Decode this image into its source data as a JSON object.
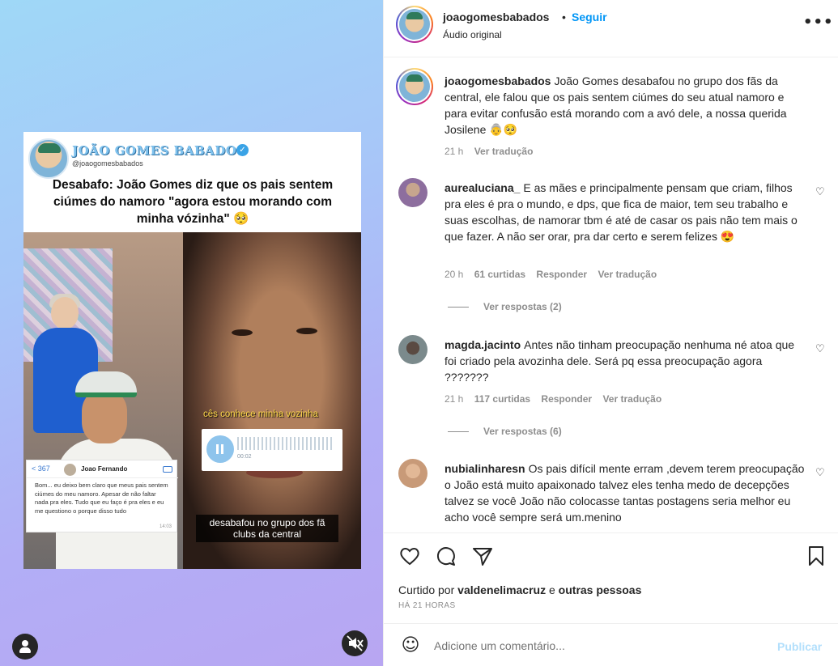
{
  "media": {
    "card_brand": "JOÃO GOMES BABADOS",
    "card_handle": "@joaogomesbabados",
    "card_headline": "Desabafo: João Gomes diz que os pais sentem ciúmes do namoro \"agora estou morando com minha vózinha\" 🥺",
    "caption_yellow": "cês conhece minha vozinha",
    "audio_time": "00:02",
    "caption_white": "desabafou no grupo dos fã clubs da central",
    "chat": {
      "back": "< 367",
      "name": "Joao Fernando",
      "message": "Bom... eu deixo bem claro que meus pais sentem ciúmes do meu namoro. Apesar de não faltar nada pra eles. Tudo que eu faço é pra eles e eu me questiono o porque disso tudo",
      "time": "14:03"
    }
  },
  "header": {
    "username": "joaogomesbabados",
    "separator": "•",
    "follow": "Seguir",
    "subtitle": "Áudio original",
    "more": "•••"
  },
  "caption": {
    "username": "joaogomesbabados",
    "text": "João Gomes desabafou no grupo dos fãs da central, ele falou que os pais sentem ciúmes do seu atual namoro e para evitar confusão está morando com a avó dele, a nossa querida Josilene 👵🥺",
    "time": "21 h",
    "translate": "Ver tradução"
  },
  "comments": [
    {
      "username": "aurealuciana_",
      "text": "E as mães e principalmente pensam que criam, filhos pra eles é pra o mundo, e dps, que fica de maior, tem seu trabalho e suas escolhas, de namorar tbm é até de casar os pais não tem mais o que fazer. A não ser orar, pra dar certo e serem felizes 😍",
      "time": "20 h",
      "likes": "61 curtidas",
      "reply": "Responder",
      "translate": "Ver tradução",
      "replies": "Ver respostas (2)",
      "avatar_color": "#8d6e9e"
    },
    {
      "username": "magda.jacinto",
      "text": "Antes não tinham preocupação nenhuma né atoa que foi criado pela avozinha dele. Será pq essa preocupação agora ???????",
      "time": "21 h",
      "likes": "117 curtidas",
      "reply": "Responder",
      "translate": "Ver tradução",
      "replies": "Ver respostas (6)",
      "avatar_color": "#7b8a8c"
    },
    {
      "username": "nubialinharesn",
      "text": "Os pais difícil mente erram ,devem terem preocupação o João está muito apaixonado talvez eles tenha medo de decepções talvez se você João não colocasse tantas postagens seria melhor eu acho você sempre será um.menino",
      "avatar_color": "#c89a78"
    }
  ],
  "actions": {
    "liked_by_prefix": "Curtido por",
    "liked_by_user": "valdenelimacruz",
    "liked_by_and": "e",
    "liked_by_others": "outras pessoas",
    "when": "HÁ 21 HORAS"
  },
  "add_comment": {
    "placeholder": "Adicione um comentário...",
    "publish": "Publicar"
  },
  "icons": {
    "heart": "♡",
    "comment": "comment-icon",
    "share": "share-icon",
    "save": "bookmark-icon",
    "emoji": "☺"
  }
}
